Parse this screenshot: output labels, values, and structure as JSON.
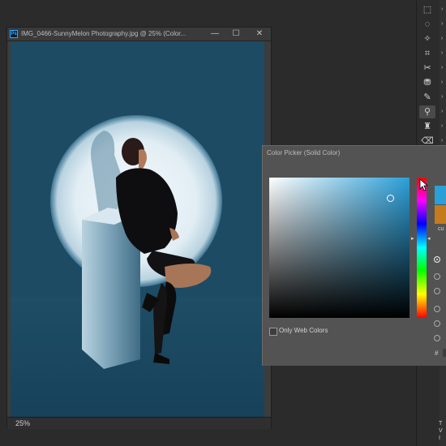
{
  "document": {
    "title": "IMG_0466-SunnyMelon Photography.jpg @ 25% (Color...",
    "app_badge": "Ps",
    "zoom": "25%",
    "window_buttons": {
      "minimize": "—",
      "maximize": "☐",
      "close": "✕"
    }
  },
  "color_picker": {
    "title": "Color Picker (Solid Color)",
    "only_web_colors_label": "Only Web Colors",
    "only_web_colors_checked": false,
    "current_label": "cu",
    "hash_label": "#",
    "new_color": "#2b9fd8",
    "current_color": "#c57a1e",
    "selected_mode_index": 0,
    "hue_arrow_left": "▸",
    "hue_arrow_right": "◂"
  },
  "tools": {
    "items": [
      {
        "name": "rectangular-marquee-tool",
        "glyph": "⬚",
        "active": false
      },
      {
        "name": "lasso-tool",
        "glyph": "◌",
        "active": false
      },
      {
        "name": "magic-wand-tool",
        "glyph": "✧",
        "active": false
      },
      {
        "name": "crop-tool",
        "glyph": "⌗",
        "active": false
      },
      {
        "name": "frame-tool",
        "glyph": "✂",
        "active": false
      },
      {
        "name": "3d-mesh-tool",
        "glyph": "⛃",
        "active": false
      },
      {
        "name": "brush-tool",
        "glyph": "✎",
        "active": false
      },
      {
        "name": "eyedropper-tool",
        "glyph": "⚲",
        "active": true
      },
      {
        "name": "clone-stamp-tool",
        "glyph": "♜",
        "active": false
      },
      {
        "name": "eraser-tool",
        "glyph": "⌫",
        "active": false
      }
    ],
    "chevron": "›"
  },
  "edge_text": "T\nV\nI"
}
